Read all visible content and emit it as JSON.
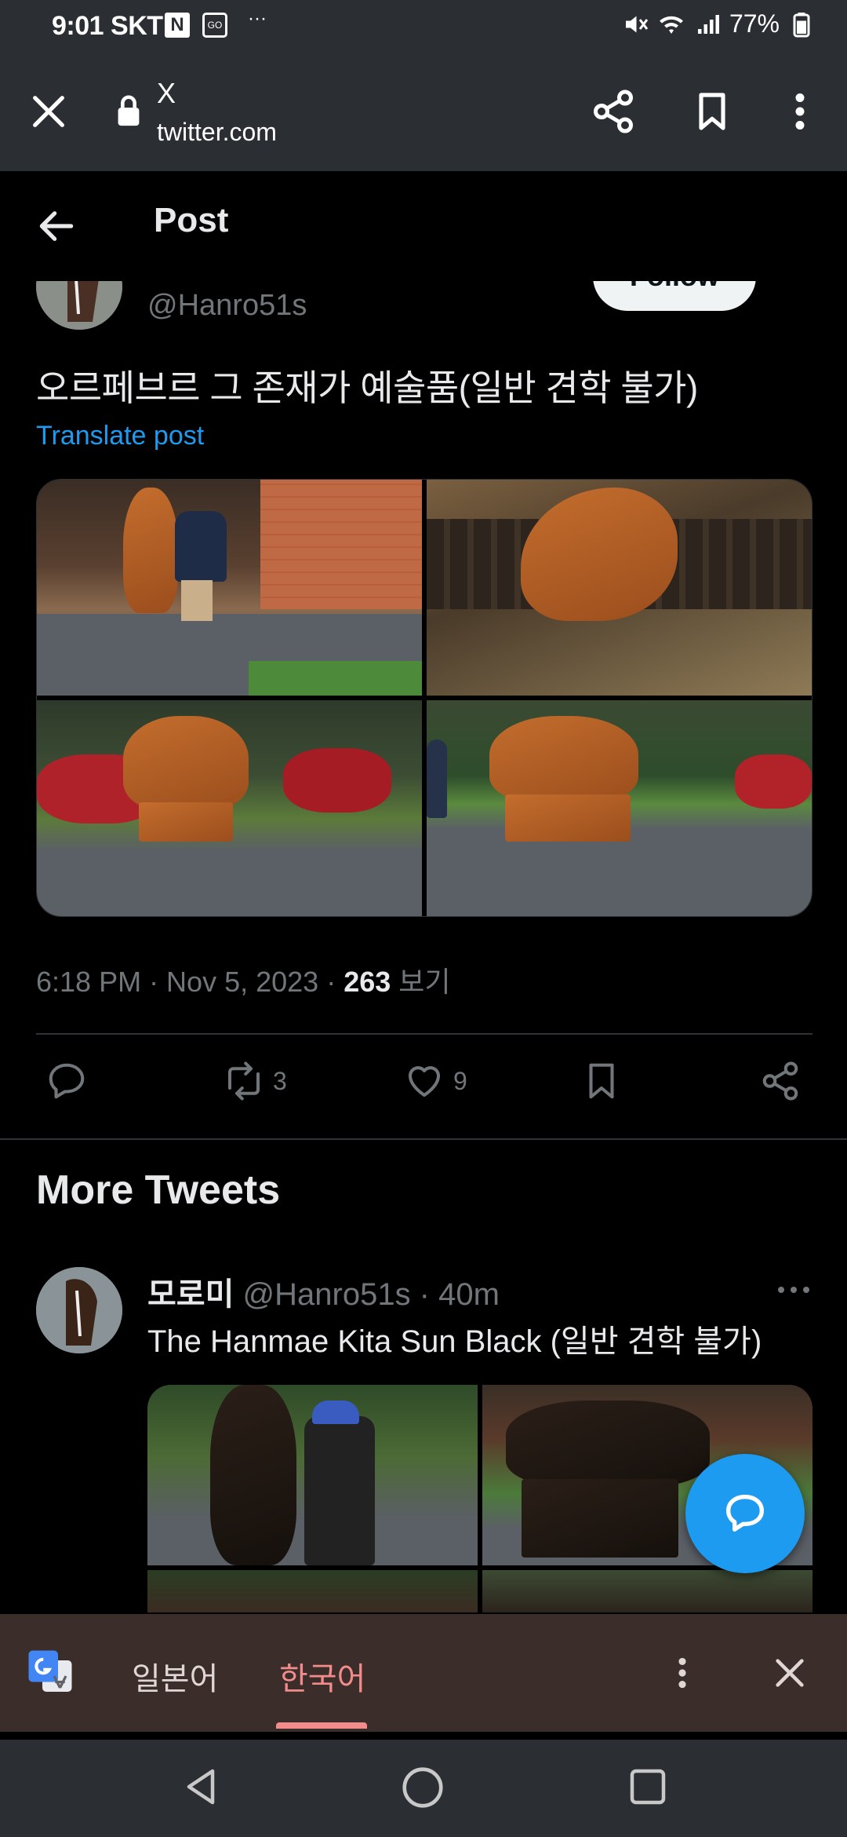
{
  "status_bar": {
    "time": "9:01",
    "carrier": "SKT",
    "n_badge": "N",
    "go_badge": "GO",
    "dots": "···",
    "battery": "77%"
  },
  "browser": {
    "title": "X",
    "url": "twitter.com"
  },
  "header": {
    "title": "Post"
  },
  "post": {
    "handle": "@Hanro51s",
    "follow_label": "Follow",
    "text": "오르페브르 그 존재가 예술품(일반 견학 불가)",
    "translate_label": "Translate post",
    "time": "6:18 PM · Nov 5, 2023 · ",
    "views_count": "263",
    "views_label": " 보기",
    "retweets": "3",
    "likes": "9"
  },
  "more_tweets": {
    "title": "More Tweets",
    "tweet": {
      "name": "모로미",
      "handle": " @Hanro51s",
      "age": " · 40m",
      "text": "The Hanmae Kita Sun Black (일반 견학 불가)"
    }
  },
  "translate_bar": {
    "lang_from": "일본어",
    "lang_to": "한국어"
  },
  "colors": {
    "accent": "#1d9bf0",
    "background": "#000000",
    "translate_bar": "#3a2d2a",
    "active_language": "#f28b8b"
  }
}
